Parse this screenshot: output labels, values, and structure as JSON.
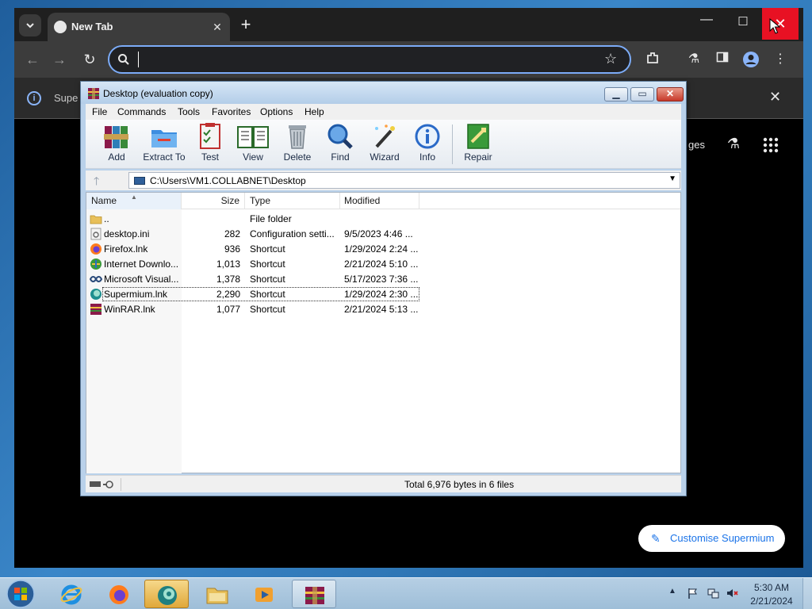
{
  "browser": {
    "tab_title": "New Tab",
    "omnibox_value": "",
    "infobar_text": "Supe",
    "ntp_link_text": "ges",
    "customise_label": "Customise Supermium"
  },
  "winrar": {
    "title": "Desktop (evaluation copy)",
    "menu": [
      "File",
      "Commands",
      "Tools",
      "Favorites",
      "Options",
      "Help"
    ],
    "toolbar": [
      "Add",
      "Extract To",
      "Test",
      "View",
      "Delete",
      "Find",
      "Wizard",
      "Info",
      "Repair"
    ],
    "path": "C:\\Users\\VM1.COLLABNET\\Desktop",
    "columns": [
      "Name",
      "Size",
      "Type",
      "Modified"
    ],
    "files": [
      {
        "name": "..",
        "size": "",
        "type": "File folder",
        "modified": "",
        "icon": "folder-icon"
      },
      {
        "name": "desktop.ini",
        "size": "282",
        "type": "Configuration setti...",
        "modified": "9/5/2023 4:46 ...",
        "icon": "settings-file-icon"
      },
      {
        "name": "Firefox.lnk",
        "size": "936",
        "type": "Shortcut",
        "modified": "1/29/2024 2:24 ...",
        "icon": "firefox-icon"
      },
      {
        "name": "Internet Downlo...",
        "size": "1,013",
        "type": "Shortcut",
        "modified": "2/21/2024 5:10 ...",
        "icon": "idm-icon"
      },
      {
        "name": "Microsoft Visual...",
        "size": "1,378",
        "type": "Shortcut",
        "modified": "5/17/2023 7:36 ...",
        "icon": "visual-studio-icon"
      },
      {
        "name": "Supermium.lnk",
        "size": "2,290",
        "type": "Shortcut",
        "modified": "1/29/2024 2:30 ...",
        "icon": "supermium-icon"
      },
      {
        "name": "WinRAR.lnk",
        "size": "1,077",
        "type": "Shortcut",
        "modified": "2/21/2024 5:13 ...",
        "icon": "winrar-icon"
      }
    ],
    "status": "Total 6,976 bytes in 6 files"
  },
  "taskbar": {
    "time": "5:30 AM",
    "date": "2/21/2024"
  }
}
